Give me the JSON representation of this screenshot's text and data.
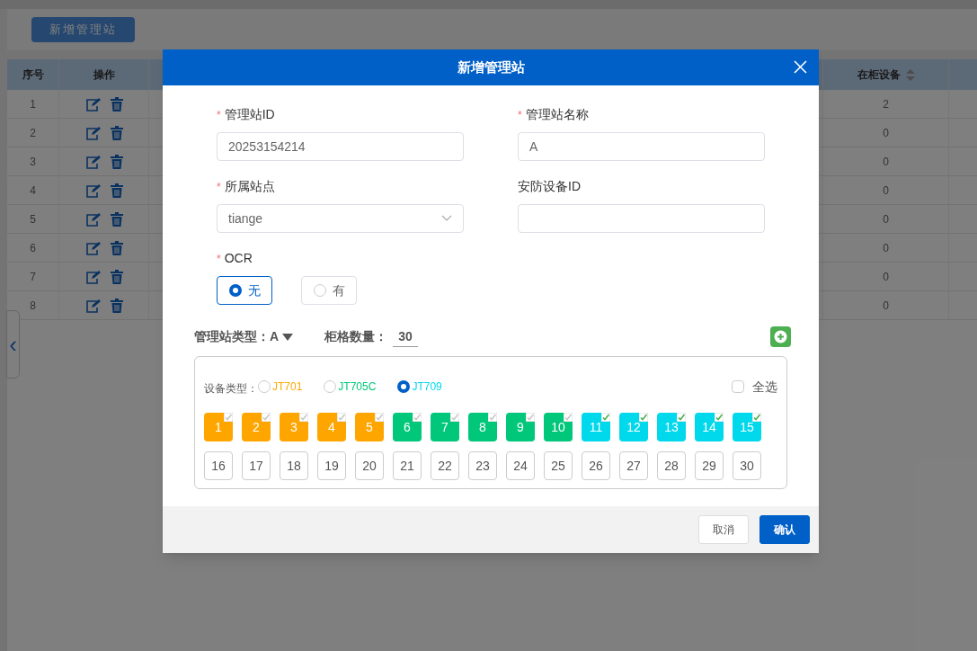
{
  "page": {
    "add_button": "新增管理站",
    "collapse_arrow": "‹"
  },
  "table": {
    "columns": [
      "序号",
      "操作",
      "在柜设备"
    ],
    "rows": [
      {
        "index": "1",
        "in_cabinet": "2"
      },
      {
        "index": "2",
        "in_cabinet": "0"
      },
      {
        "index": "3",
        "in_cabinet": "0"
      },
      {
        "index": "4",
        "in_cabinet": "0"
      },
      {
        "index": "5",
        "in_cabinet": "0"
      },
      {
        "index": "6",
        "in_cabinet": "0"
      },
      {
        "index": "7",
        "in_cabinet": "0"
      },
      {
        "index": "8",
        "in_cabinet": "0"
      }
    ]
  },
  "dialog": {
    "title": "新增管理站",
    "fields": [
      {
        "label": "管理站ID",
        "required_mark": "*",
        "kind": "input",
        "value": "20253154214"
      },
      {
        "label": "管理站名称",
        "required_mark": "*",
        "kind": "input",
        "value": "A"
      },
      {
        "label": "所属站点",
        "required_mark": "*",
        "kind": "select",
        "value": "tiange"
      },
      {
        "label": "安防设备ID",
        "kind": "input"
      }
    ],
    "ocr": {
      "label": "OCR",
      "required_mark": "*",
      "options": [
        {
          "label": "无",
          "selected": true
        },
        {
          "label": "有",
          "selected": false
        }
      ]
    },
    "station_type": {
      "label": "管理站类型：",
      "value": "A"
    },
    "slot_count": {
      "label": "柜格数量：",
      "value": "30"
    },
    "device_type_label": "设备类型：",
    "device_types": [
      {
        "label": "JT701",
        "color": "#ffa500",
        "selected": false
      },
      {
        "label": "JT705C",
        "color": "#00c77a",
        "selected": false
      },
      {
        "label": "JT709",
        "color": "#00d8ec",
        "selected": true
      }
    ],
    "select_all": {
      "label": "全选",
      "checked": false
    },
    "slots": [
      {
        "label": "1",
        "kind": "occupied",
        "color": "#ffa500",
        "checked": false
      },
      {
        "label": "2",
        "kind": "occupied",
        "color": "#ffa500",
        "checked": false
      },
      {
        "label": "3",
        "kind": "occupied",
        "color": "#ffa500",
        "checked": false
      },
      {
        "label": "4",
        "kind": "occupied",
        "color": "#ffa500",
        "checked": false
      },
      {
        "label": "5",
        "kind": "occupied",
        "color": "#ffa500",
        "checked": false
      },
      {
        "label": "6",
        "kind": "occupied",
        "color": "#00c77a",
        "checked": false
      },
      {
        "label": "7",
        "kind": "occupied",
        "color": "#00c77a",
        "checked": false
      },
      {
        "label": "8",
        "kind": "occupied",
        "color": "#00c77a",
        "checked": false
      },
      {
        "label": "9",
        "kind": "occupied",
        "color": "#00c77a",
        "checked": false
      },
      {
        "label": "10",
        "kind": "occupied",
        "color": "#00c77a",
        "checked": false
      },
      {
        "label": "11",
        "kind": "occupied",
        "color": "#00d8ec",
        "checked": true
      },
      {
        "label": "12",
        "kind": "occupied",
        "color": "#00d8ec",
        "checked": true
      },
      {
        "label": "13",
        "kind": "occupied",
        "color": "#00d8ec",
        "checked": true
      },
      {
        "label": "14",
        "kind": "occupied",
        "color": "#00d8ec",
        "checked": true
      },
      {
        "label": "15",
        "kind": "occupied",
        "color": "#00d8ec",
        "checked": true
      },
      {
        "label": "16",
        "kind": "empty"
      },
      {
        "label": "17",
        "kind": "empty"
      },
      {
        "label": "18",
        "kind": "empty"
      },
      {
        "label": "19",
        "kind": "empty"
      },
      {
        "label": "20",
        "kind": "empty"
      },
      {
        "label": "21",
        "kind": "empty"
      },
      {
        "label": "22",
        "kind": "empty"
      },
      {
        "label": "23",
        "kind": "empty"
      },
      {
        "label": "24",
        "kind": "empty"
      },
      {
        "label": "25",
        "kind": "empty"
      },
      {
        "label": "26",
        "kind": "empty"
      },
      {
        "label": "27",
        "kind": "empty"
      },
      {
        "label": "28",
        "kind": "empty"
      },
      {
        "label": "29",
        "kind": "empty"
      },
      {
        "label": "30",
        "kind": "empty"
      }
    ],
    "buttons": [
      {
        "label": "取消",
        "kind": "secondary"
      },
      {
        "label": "确认",
        "kind": "primary"
      }
    ]
  }
}
